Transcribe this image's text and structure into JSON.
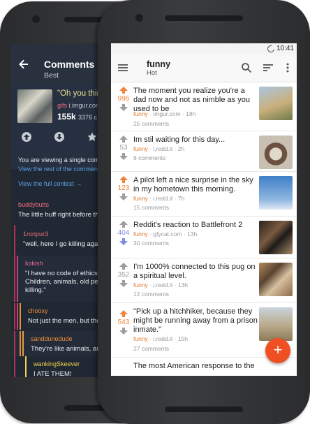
{
  "back_screen": {
    "title": "Comments",
    "sort": "Best",
    "post": {
      "title": "\"Oh you think",
      "subreddit": "gifs",
      "domain": "i.imgur.com",
      "score": "155k",
      "comments": "3376 c"
    },
    "single_note": "You are viewing a single com",
    "rest_link": "View the rest of the comments",
    "full_context": "View the full context →",
    "comments": [
      {
        "user": "buddybutts",
        "text": "The little huff right before th",
        "color": "#f16c7a"
      },
      {
        "user": "1ronpur3",
        "text": "\"well, here I go killing agai",
        "color": "#f16c7a"
      },
      {
        "user": "kokish",
        "text": "\"I have no code of ethics, Children, animals, old peo killing.\"",
        "color": "#ec6b8d"
      },
      {
        "user": "chooxy",
        "text": "Not just the men, but the",
        "color": "#f08b3a"
      },
      {
        "user": "sanddunedude",
        "text": "They're like animals, and",
        "color": "#f08b3a"
      },
      {
        "user": "wankingSkeever",
        "text": "I ATE THEM!",
        "color": "#f2d04d"
      }
    ]
  },
  "front_screen": {
    "status_time": "10:41",
    "subreddit": "funny",
    "sort": "Hot",
    "posts": [
      {
        "score": "996",
        "voted": "up",
        "title": "The moment you realize you're a dad now and not as nimble as you used to be",
        "sub": "funny",
        "domain": "imgur.com",
        "age": "18h",
        "comments": "25 comments"
      },
      {
        "score": "53",
        "voted": "none",
        "title": "Im stil waiting for this day...",
        "sub": "funny",
        "domain": "i.redd.it",
        "age": "2h",
        "comments": "6 comments"
      },
      {
        "score": "123",
        "voted": "up",
        "title": "A pilot left a nice surprise in the sky in my hometown this morning.",
        "sub": "funny",
        "domain": "i.redd.it",
        "age": "7h",
        "comments": "15 comments"
      },
      {
        "score": "404",
        "voted": "down",
        "title": "Reddit's reaction to Battlefront 2",
        "sub": "funny",
        "domain": "gfycat.com",
        "age": "13h",
        "comments": "30 comments"
      },
      {
        "score": "352",
        "voted": "none",
        "title": "I'm 1000% connected to this pug on a spiritual level.",
        "sub": "funny",
        "domain": "i.redd.it",
        "age": "13h",
        "comments": "12 comments"
      },
      {
        "score": "543",
        "voted": "up",
        "title": "\"Pick up a hitchhiker, because they might be running away from a prison inmate.\"",
        "sub": "funny",
        "domain": "i.redd.it",
        "age": "15h",
        "comments": "27 comments"
      },
      {
        "score": "",
        "voted": "none",
        "title": "The most American response to the",
        "sub": "",
        "domain": "",
        "age": "",
        "comments": ""
      }
    ],
    "fab_label": "+"
  },
  "colors": {
    "upvote": "#f0833a",
    "downvote": "#7d8ce0",
    "neutral": "#9e9e9e",
    "accent": "#f04e23"
  },
  "icons": [
    "back-arrow-icon",
    "upvote-icon",
    "downvote-icon",
    "star-icon",
    "menu-icon",
    "search-icon",
    "sort-icon",
    "more-vert-icon",
    "add-icon"
  ]
}
